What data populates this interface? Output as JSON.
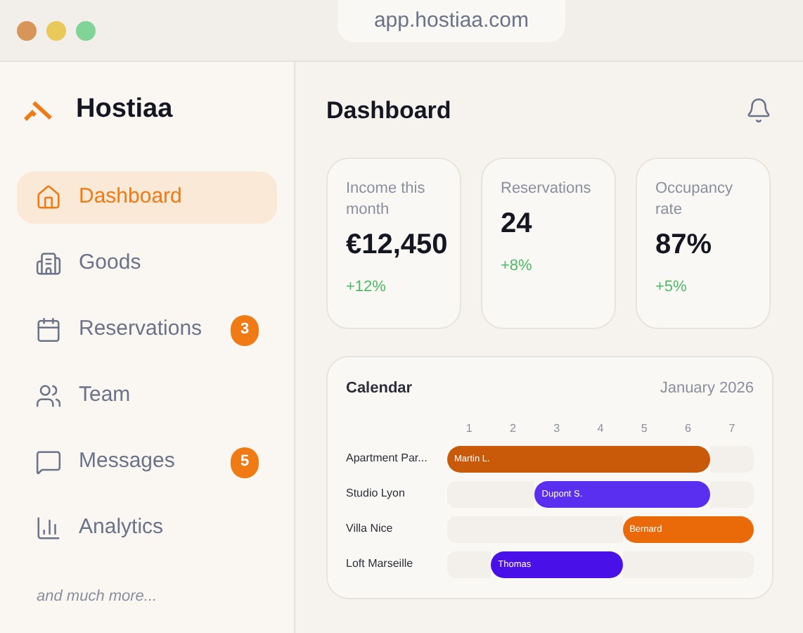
{
  "browser": {
    "url": "app.hostiaa.com"
  },
  "brand": {
    "name": "Hostiaa"
  },
  "sidebar": {
    "items": [
      {
        "label": "Dashboard",
        "selected": true
      },
      {
        "label": "Goods",
        "selected": false
      },
      {
        "label": "Reservations",
        "selected": false,
        "badge": "3"
      },
      {
        "label": "Team",
        "selected": false
      },
      {
        "label": "Messages",
        "selected": false,
        "badge": "5"
      },
      {
        "label": "Analytics",
        "selected": false
      }
    ],
    "footer": "and much more..."
  },
  "header": {
    "title": "Dashboard"
  },
  "stats": [
    {
      "label": "Income this month",
      "value": "€12,450",
      "change": "+12%"
    },
    {
      "label": "Reservations",
      "value": "24",
      "change": "+8%"
    },
    {
      "label": "Occupancy rate",
      "value": "87%",
      "change": "+5%"
    }
  ],
  "calendar": {
    "title": "Calendar",
    "month": "January 2026",
    "days": [
      "1",
      "2",
      "3",
      "4",
      "5",
      "6",
      "7"
    ],
    "rows": [
      {
        "property": "Apartment Par...",
        "guest": "Martin L.",
        "booked": [
          true,
          true,
          true,
          true,
          true,
          true,
          false
        ],
        "color": "#c85a0a"
      },
      {
        "property": "Studio Lyon",
        "guest": "Dupont S.",
        "booked": [
          false,
          false,
          true,
          true,
          true,
          true,
          false
        ],
        "color": "#5a2ff0"
      },
      {
        "property": "Villa Nice",
        "guest": "Bernard",
        "booked": [
          false,
          false,
          false,
          false,
          true,
          true,
          true
        ],
        "color": "#ea6a0a"
      },
      {
        "property": "Loft Marseille",
        "guest": "Thomas",
        "booked": [
          false,
          true,
          true,
          true,
          false,
          false,
          false
        ],
        "color": "#4a10e8"
      }
    ]
  }
}
